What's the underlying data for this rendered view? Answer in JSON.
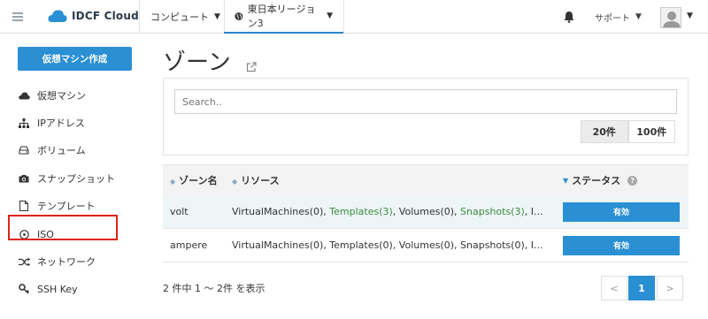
{
  "header": {
    "brand": "IDCF Cloud",
    "compute_menu": "コンピュート",
    "region_menu": "東日本リージョン3",
    "support_menu": "サポート"
  },
  "sidebar": {
    "create_button": "仮想マシン作成",
    "items": [
      {
        "label": "仮想マシン",
        "icon": "cloud-icon"
      },
      {
        "label": "IPアドレス",
        "icon": "sitemap-icon"
      },
      {
        "label": "ボリューム",
        "icon": "hdd-icon"
      },
      {
        "label": "スナップショット",
        "icon": "camera-icon"
      },
      {
        "label": "テンプレート",
        "icon": "file-icon"
      },
      {
        "label": "ISO",
        "icon": "disc-icon"
      },
      {
        "label": "ネットワーク",
        "icon": "shuffle-icon"
      },
      {
        "label": "SSH Key",
        "icon": "key-icon"
      }
    ]
  },
  "page": {
    "title": "ゾーン",
    "search_placeholder": "Search..",
    "page_size_options": [
      "20件",
      "100件"
    ],
    "selected_page_size": "20件"
  },
  "table": {
    "headers": [
      "ゾーン名",
      "リソース",
      "ステータス"
    ],
    "rows": [
      {
        "zone": "volt",
        "resources": [
          {
            "text": "VirtualMachines(0), ",
            "link": false
          },
          {
            "text": "Templates(3)",
            "link": true
          },
          {
            "text": ", Volumes(0), ",
            "link": false
          },
          {
            "text": "Snapshots(3)",
            "link": true
          },
          {
            "text": ", I...",
            "link": false
          }
        ],
        "status": "有効"
      },
      {
        "zone": "ampere",
        "resources": [
          {
            "text": "VirtualMachines(0), Templates(0), Volumes(0), Snapshots(0), I...",
            "link": false
          }
        ],
        "status": "有効"
      }
    ]
  },
  "footer": {
    "count_text": "2 件中 1 ～ 2件 を表示",
    "prev": "<",
    "current_page": "1",
    "next": ">"
  },
  "colors": {
    "accent": "#2a8fd3",
    "link_green": "#3a8c3a",
    "highlight_red": "#e0211a"
  }
}
